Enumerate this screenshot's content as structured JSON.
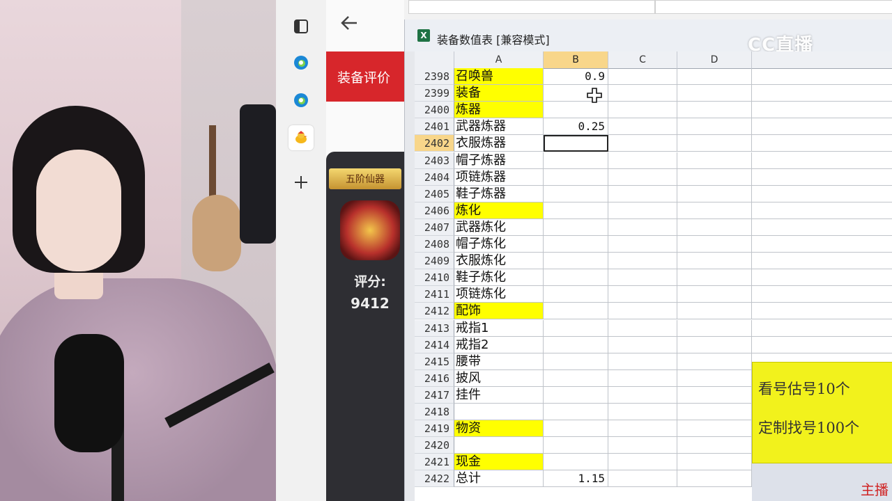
{
  "window": {
    "title": "装备数值表  [兼容模式]",
    "watermark": "CC直播"
  },
  "webpanel": {
    "tab_label": "装备评价",
    "grade_badge": "五阶仙器",
    "score_label": "评分:",
    "score_value": "9412"
  },
  "columns": [
    "A",
    "B",
    "C",
    "D"
  ],
  "rows": [
    {
      "n": "2398",
      "a": "召唤兽",
      "b": "0.9",
      "hl": true
    },
    {
      "n": "2399",
      "a": "装备",
      "b": "",
      "hl": true
    },
    {
      "n": "2400",
      "a": "炼器",
      "b": "",
      "hl": true
    },
    {
      "n": "2401",
      "a": "武器炼器",
      "b": "0.25",
      "hl": false
    },
    {
      "n": "2402",
      "a": "衣服炼器",
      "b": "",
      "hl": false,
      "selected": true
    },
    {
      "n": "2403",
      "a": "帽子炼器",
      "b": "",
      "hl": false
    },
    {
      "n": "2404",
      "a": "项链炼器",
      "b": "",
      "hl": false
    },
    {
      "n": "2405",
      "a": "鞋子炼器",
      "b": "",
      "hl": false
    },
    {
      "n": "2406",
      "a": "炼化",
      "b": "",
      "hl": true
    },
    {
      "n": "2407",
      "a": "武器炼化",
      "b": "",
      "hl": false
    },
    {
      "n": "2408",
      "a": "帽子炼化",
      "b": "",
      "hl": false
    },
    {
      "n": "2409",
      "a": "衣服炼化",
      "b": "",
      "hl": false
    },
    {
      "n": "2410",
      "a": "鞋子炼化",
      "b": "",
      "hl": false
    },
    {
      "n": "2411",
      "a": "项链炼化",
      "b": "",
      "hl": false
    },
    {
      "n": "2412",
      "a": "配饰",
      "b": "",
      "hl": true
    },
    {
      "n": "2413",
      "a": "戒指1",
      "b": "",
      "hl": false
    },
    {
      "n": "2414",
      "a": "戒指2",
      "b": "",
      "hl": false
    },
    {
      "n": "2415",
      "a": "腰带",
      "b": "",
      "hl": false
    },
    {
      "n": "2416",
      "a": "披风",
      "b": "",
      "hl": false
    },
    {
      "n": "2417",
      "a": "挂件",
      "b": "",
      "hl": false
    },
    {
      "n": "2418",
      "a": "",
      "b": "",
      "hl": false
    },
    {
      "n": "2419",
      "a": "物资",
      "b": "",
      "hl": true
    },
    {
      "n": "2420",
      "a": "",
      "b": "",
      "hl": false
    },
    {
      "n": "2421",
      "a": "现金",
      "b": "",
      "hl": true
    },
    {
      "n": "2422",
      "a": "总计",
      "b": "1.15",
      "hl": false
    }
  ],
  "promo": {
    "line1": "看号估号10个",
    "line2": "定制找号100个",
    "line3": "主播"
  },
  "colors": {
    "highlight": "#ffff00",
    "accent_red": "#d7262b",
    "selected_header": "#f8d68a"
  },
  "icons": [
    "back-arrow-icon",
    "tab-icon",
    "edge-icon",
    "chick-icon",
    "plus-icon",
    "excel-icon",
    "cell-cursor-icon"
  ]
}
